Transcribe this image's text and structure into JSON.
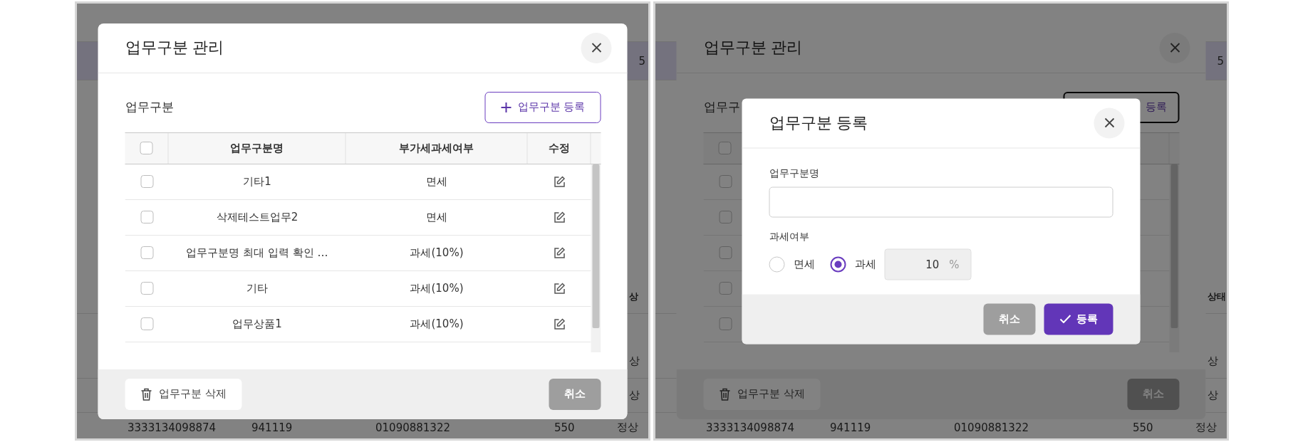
{
  "screens": [
    {
      "background": {
        "highlight_value": "5",
        "status_header": "상",
        "status_rows": [
          "상",
          "상"
        ],
        "bottom_row": [
          "3333134098874",
          "941119",
          "01090881322",
          "550",
          "정상"
        ]
      },
      "modal": {
        "title": "업무구분 관리",
        "section_label": "업무구분",
        "add_button": {
          "label": "업무구분 등록",
          "icon": true,
          "focused": false
        },
        "table": {
          "columns": [
            "업무구분명",
            "부가세과세여부",
            "수정"
          ],
          "header_checked": false,
          "rows": [
            {
              "name": "기타1",
              "vat": "면세",
              "checked": false
            },
            {
              "name": "삭제테스트업무2",
              "vat": "면세",
              "checked": false
            },
            {
              "name": "업무구분명 최대 입력 확인 …",
              "vat": "과세(10%)",
              "checked": false
            },
            {
              "name": "기타",
              "vat": "과세(10%)",
              "checked": false
            },
            {
              "name": "업무상품1",
              "vat": "과세(10%)",
              "checked": false
            }
          ]
        },
        "delete_button": "업무구분 삭제",
        "cancel_button": "취소"
      }
    },
    {
      "background": {
        "highlight_value": "5",
        "status_header": "상태",
        "status_rows": [
          "상",
          "상"
        ],
        "bottom_row": [
          "3333134098874",
          "941119",
          "01090881322",
          "550",
          "정상"
        ]
      },
      "modal": {
        "title": "업무구분 관리",
        "section_label": "업무구",
        "add_button": {
          "label": "등록",
          "icon": false,
          "focused": true
        },
        "table": {
          "header_checked": false,
          "rows": [
            {
              "checked": false
            },
            {
              "checked": false
            },
            {
              "checked": false
            },
            {
              "checked": false
            },
            {
              "checked": false
            }
          ]
        },
        "delete_button": "업무구분 삭제",
        "cancel_button": "취소"
      },
      "dialog": {
        "title": "업무구분 등록",
        "name_label": "업무구분명",
        "tax_label": "과세여부",
        "options": [
          {
            "label": "면세",
            "selected": false
          },
          {
            "label": "과세",
            "selected": true
          }
        ],
        "rate": "10",
        "rate_unit": "%",
        "cancel_button": "취소",
        "submit_button": "등록"
      }
    }
  ]
}
